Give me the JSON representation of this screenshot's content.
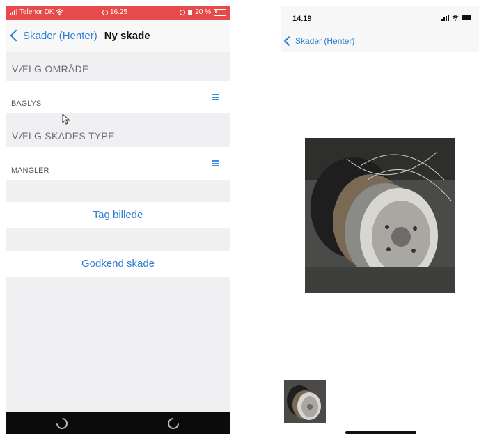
{
  "left_phone": {
    "status_bar": {
      "carrier": "Telenor DK",
      "time": "16.25",
      "battery": "20 %"
    },
    "nav": {
      "back_label": "Skader (Henter)",
      "title": "Ny skade"
    },
    "sections": [
      {
        "header": "VÆLG OMRÅDE",
        "value": "BAGLYS"
      },
      {
        "header": "VÆLG SKADES TYPE",
        "value": "MANGLER"
      }
    ],
    "buttons": {
      "take_photo": "Tag billede",
      "approve": "Godkend skade"
    }
  },
  "right_phone": {
    "status_bar": {
      "time": "14.19"
    },
    "nav": {
      "back_label": "Skader (Henter)"
    }
  },
  "colors": {
    "accent": "#2c7fd4",
    "status_red": "#e64a4a"
  },
  "icons": [
    "wifi-icon",
    "signal-icon",
    "battery-icon",
    "menu-lines-icon",
    "chevron-left-icon",
    "rotate-left-icon",
    "rotate-right-icon",
    "cursor-arrow-icon"
  ]
}
